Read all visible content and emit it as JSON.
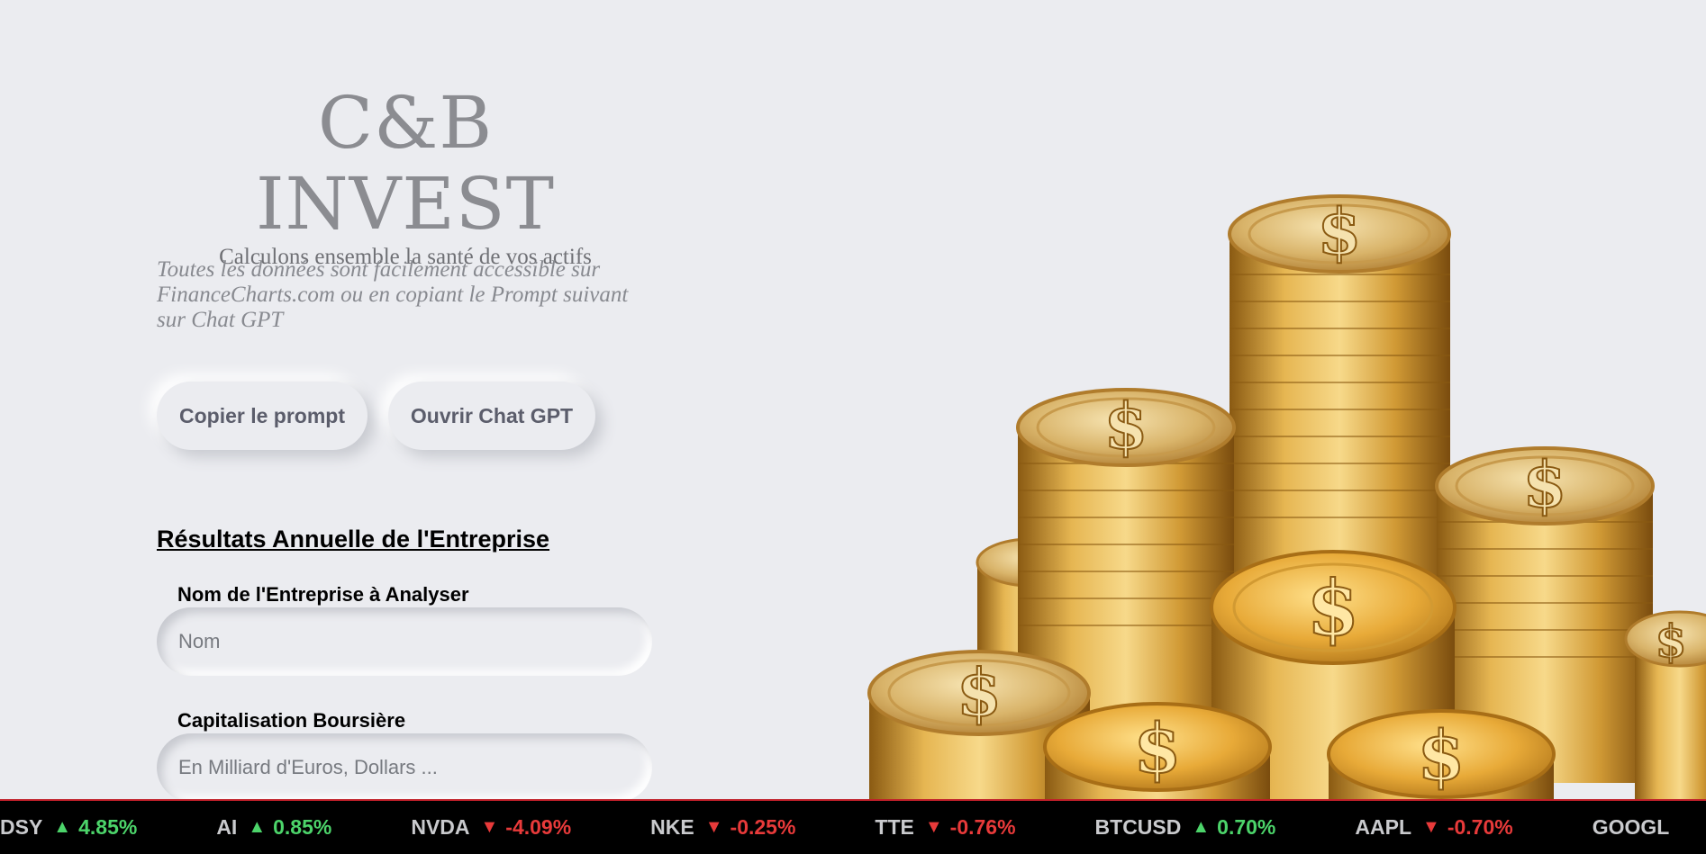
{
  "brand": {
    "title": "C&B INVEST",
    "subtitle": "Calculons ensemble la santé de vos actifs"
  },
  "intro": {
    "text": "Toutes les données sont facilement accessible sur FinanceCharts.com ou en copiant le Prompt suivant sur Chat GPT"
  },
  "actions": {
    "copy_label": "Copier le prompt",
    "open_label": "Ouvrir Chat GPT"
  },
  "form": {
    "section_title": "Résultats Annuelle de l'Entreprise",
    "fields": [
      {
        "label": "Nom de l'Entreprise à Analyser",
        "placeholder": "Nom",
        "value": ""
      },
      {
        "label": "Capitalisation Boursière",
        "placeholder": "En Milliard d'Euros, Dollars ...",
        "value": ""
      }
    ]
  },
  "ticker": {
    "items": [
      {
        "symbol": "DSY",
        "direction": "up",
        "arrow": "▲",
        "change": "4.85%"
      },
      {
        "symbol": "AI",
        "direction": "up",
        "arrow": "▲",
        "change": "0.85%"
      },
      {
        "symbol": "NVDA",
        "direction": "down",
        "arrow": "▼",
        "change": "-4.09%"
      },
      {
        "symbol": "NKE",
        "direction": "down",
        "arrow": "▼",
        "change": "-0.25%"
      },
      {
        "symbol": "TTE",
        "direction": "down",
        "arrow": "▼",
        "change": "-0.76%"
      },
      {
        "symbol": "BTCUSD",
        "direction": "up",
        "arrow": "▲",
        "change": "0.70%"
      },
      {
        "symbol": "AAPL",
        "direction": "down",
        "arrow": "▼",
        "change": "-0.70%"
      },
      {
        "symbol": "GOOGL",
        "direction": "",
        "arrow": "",
        "change": ""
      }
    ]
  },
  "colors": {
    "background": "#ebecf0",
    "up": "#4cd46a",
    "down": "#e83a3a",
    "gold": "#d9a63a"
  },
  "hero_image": {
    "icon": "dollar-coin-stack-icon",
    "coin_symbol": "$"
  }
}
